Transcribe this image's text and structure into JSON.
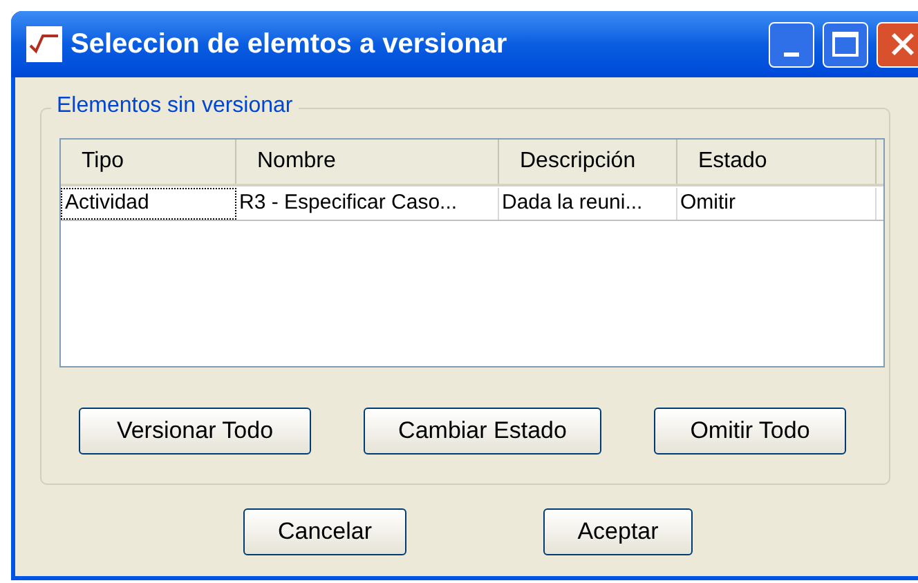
{
  "window": {
    "title": "Seleccion de elemtos a versionar"
  },
  "group": {
    "legend": "Elementos sin versionar"
  },
  "table": {
    "columns": [
      "Tipo",
      "Nombre",
      "Descripción",
      "Estado"
    ],
    "rows": [
      {
        "cells": [
          "Actividad",
          "R3 - Especificar Caso...",
          "Dada la reuni...",
          "Omitir"
        ],
        "focused": true
      }
    ]
  },
  "actions": [
    "Versionar Todo",
    "Cambiar Estado",
    "Omitir Todo"
  ],
  "buttons": [
    "Cancelar",
    "Aceptar"
  ]
}
